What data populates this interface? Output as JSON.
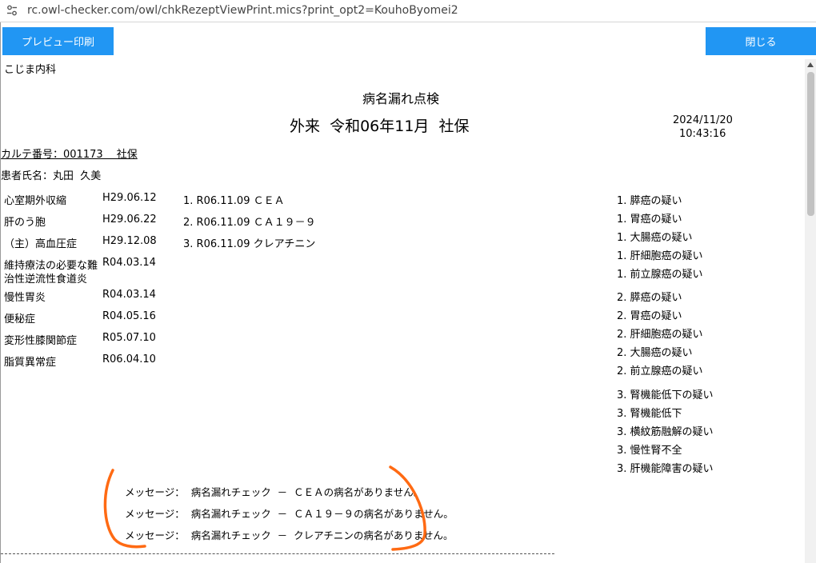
{
  "browser": {
    "url": "rc.owl-checker.com/owl/chkRezeptViewPrint.mics?print_opt2=KouhoByomei2",
    "tune_icon": "tune-icon"
  },
  "toolbar": {
    "preview_print_label": "プレビュー印刷",
    "close_label": "閉じる"
  },
  "report": {
    "clinic": "こじま内科",
    "title": "病名漏れ点検",
    "subtitle": "外来  令和06年11月  社保",
    "date": "2024/11/20",
    "time": "10:43:16",
    "karte": "カルテ番号：001173　 社保",
    "patient": "患者氏名：丸田  久美"
  },
  "diseases": [
    {
      "name": "心室期外収縮",
      "date": "H29.06.12"
    },
    {
      "name": "肝のう胞",
      "date": "H29.06.22"
    },
    {
      "name": "（主）高血圧症",
      "date": "H29.12.08"
    },
    {
      "name": "維持療法の必要な難",
      "name2": "治性逆流性食道炎",
      "date": "R04.03.14"
    },
    {
      "name": "慢性胃炎",
      "date": "R04.03.14"
    },
    {
      "name": "便秘症",
      "date": "R04.05.16"
    },
    {
      "name": "変形性膝関節症",
      "date": "R05.07.10"
    },
    {
      "name": "脂質異常症",
      "date": "R06.04.10"
    }
  ],
  "tests": [
    "1. R06.11.09 ＣＥＡ",
    "2. R06.11.09 ＣＡ１９－９",
    "3. R06.11.09 クレアチニン"
  ],
  "candidates": [
    "1. 膵癌の疑い",
    "1. 胃癌の疑い",
    "1. 大腸癌の疑い",
    "1. 肝細胞癌の疑い",
    "1. 前立腺癌の疑い",
    "2. 膵癌の疑い",
    "2. 胃癌の疑い",
    "2. 肝細胞癌の疑い",
    "2. 大腸癌の疑い",
    "2. 前立腺癌の疑い",
    "3. 腎機能低下の疑い",
    "3. 腎機能低下",
    "3. 横紋筋融解の疑い",
    "3. 慢性腎不全",
    "3. 肝機能障害の疑い"
  ],
  "messages": [
    "メッセージ：  病名漏れチェック  －  ＣＥＡの病名がありません。",
    "メッセージ：  病名漏れチェック  －  ＣＡ１９－９の病名がありません。",
    "メッセージ：  病名漏れチェック  －  クレアチニンの病名がありません。"
  ],
  "colors": {
    "button": "#2196f3",
    "annotation": "#ff6a13"
  }
}
